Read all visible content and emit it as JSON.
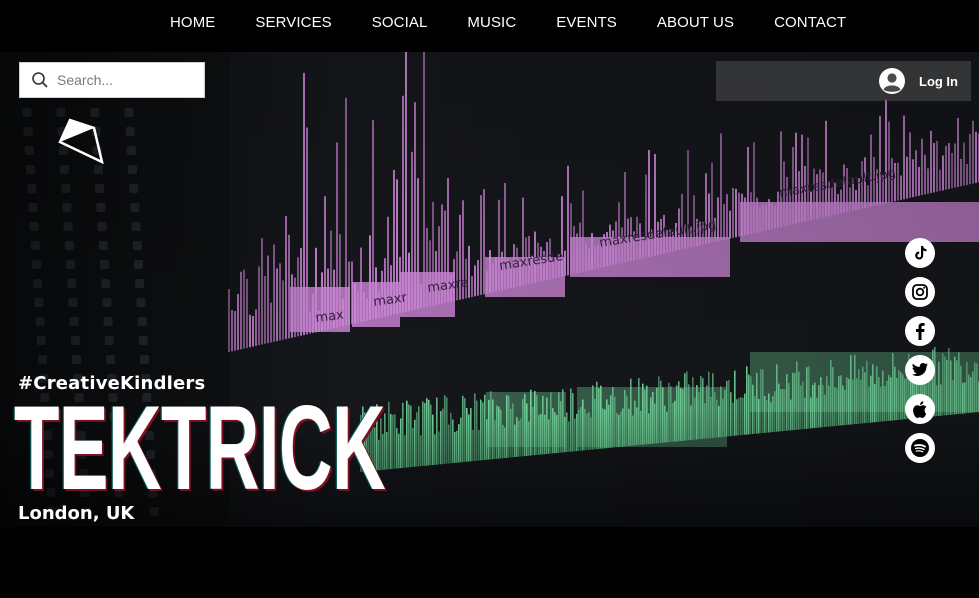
{
  "nav": {
    "items": [
      {
        "label": "HOME"
      },
      {
        "label": "SERVICES"
      },
      {
        "label": "SOCIAL"
      },
      {
        "label": "MUSIC"
      },
      {
        "label": "EVENTS"
      },
      {
        "label": "ABOUT US"
      },
      {
        "label": "CONTACT"
      }
    ]
  },
  "search": {
    "placeholder": "Search...",
    "icon": "search-icon"
  },
  "header": {
    "login_label": "Log In",
    "login_icon": "account-avatar-icon",
    "logo_icon": "prism-logo-icon"
  },
  "social": [
    {
      "name": "TikTok",
      "icon": "tiktok-icon"
    },
    {
      "name": "Instagram",
      "icon": "instagram-icon"
    },
    {
      "name": "Facebook",
      "icon": "facebook-icon"
    },
    {
      "name": "Twitter",
      "icon": "twitter-icon"
    },
    {
      "name": "Apple",
      "icon": "apple-icon"
    },
    {
      "name": "Spotify",
      "icon": "spotify-icon"
    }
  ],
  "hero": {
    "hashtag": "#CreativeKindlers",
    "brand": "TEKTRICK",
    "location": "London, UK",
    "timeline_clip_labels": [
      "maxresdefault.jpg",
      "maxresde",
      "maxresdefault.jpg",
      "maxre",
      "maxr",
      "max"
    ]
  },
  "colors": {
    "nav_bg": "#000000",
    "clip_pink": "#d58ce0",
    "clip_green": "#7be3a6",
    "text": "#ffffff"
  }
}
